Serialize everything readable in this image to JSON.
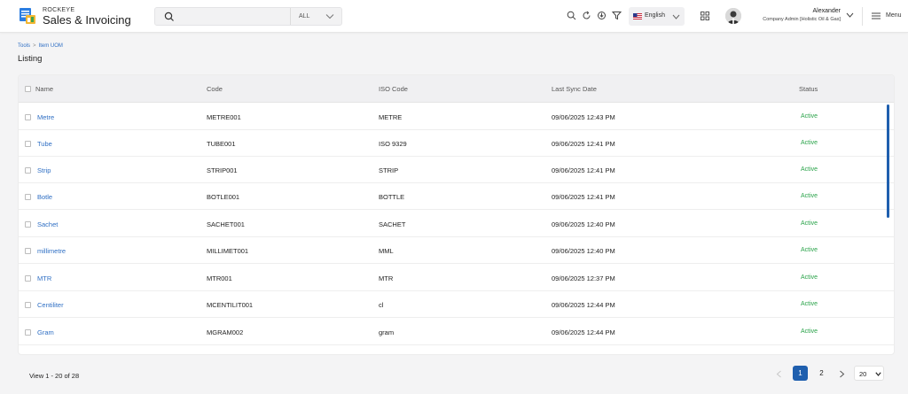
{
  "brand": {
    "small": "ROCKEYE",
    "big": "Sales & Invoicing"
  },
  "search": {
    "placeholder": "",
    "filter": "ALL"
  },
  "language": "English",
  "user": {
    "name": "Alexander",
    "role": "Company Admin [Holistic Oil & Gas]"
  },
  "menu_label": "Menu",
  "breadcrumb": {
    "root": "Tools",
    "sep": ">",
    "current": "Item UOM"
  },
  "page_title": "Listing",
  "table": {
    "headers": {
      "name": "Name",
      "code": "Code",
      "iso": "ISO Code",
      "sync": "Last Sync Date",
      "status": "Status"
    },
    "rows": [
      {
        "name": "Metre",
        "code": "METRE001",
        "iso": "METRE",
        "sync": "09/06/2025 12:43 PM",
        "status": "Active"
      },
      {
        "name": "Tube",
        "code": "TUBE001",
        "iso": "ISO 9329",
        "sync": "09/06/2025 12:41 PM",
        "status": "Active"
      },
      {
        "name": "Strip",
        "code": "STRIP001",
        "iso": "STRIP",
        "sync": "09/06/2025 12:41 PM",
        "status": "Active"
      },
      {
        "name": "Botle",
        "code": "BOTLE001",
        "iso": "BOTTLE",
        "sync": "09/06/2025 12:41 PM",
        "status": "Active"
      },
      {
        "name": "Sachet",
        "code": "SACHET001",
        "iso": "SACHET",
        "sync": "09/06/2025 12:40 PM",
        "status": "Active"
      },
      {
        "name": "millimetre",
        "code": "MILLIMET001",
        "iso": "MML",
        "sync": "09/06/2025 12:40 PM",
        "status": "Active"
      },
      {
        "name": "MTR",
        "code": "MTR001",
        "iso": "MTR",
        "sync": "09/06/2025 12:37 PM",
        "status": "Active"
      },
      {
        "name": "Centiliter",
        "code": "MCENTILIT001",
        "iso": "cl",
        "sync": "09/06/2025 12:44 PM",
        "status": "Active"
      },
      {
        "name": "Gram",
        "code": "MGRAM002",
        "iso": "gram",
        "sync": "09/06/2025 12:44 PM",
        "status": "Active"
      }
    ]
  },
  "pagination": {
    "summary": "View 1 - 20 of 28",
    "pages": [
      "1",
      "2"
    ],
    "current": "1",
    "page_size": "20"
  },
  "colors": {
    "accent": "#1f5fae",
    "link": "#2f6fc4",
    "active_status": "#2aa34a"
  }
}
